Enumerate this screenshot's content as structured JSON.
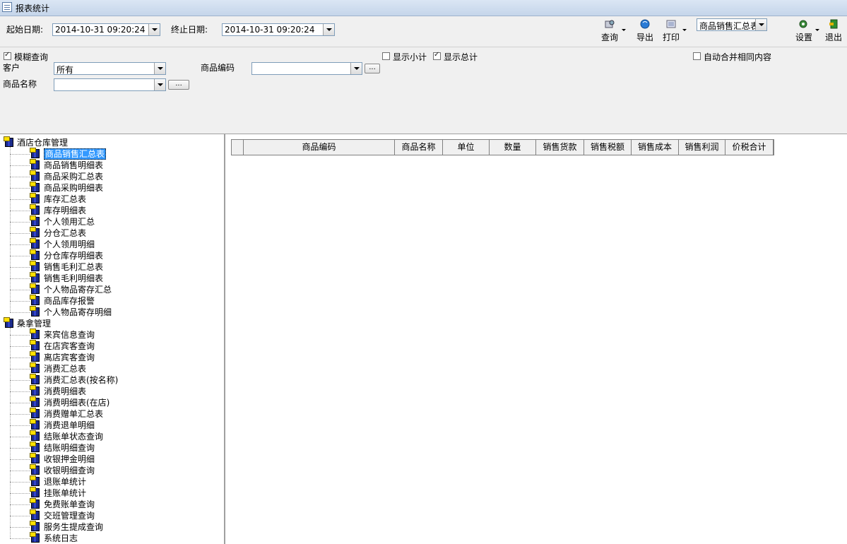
{
  "window": {
    "title": "报表统计"
  },
  "toolbar": {
    "start_label": "起始日期:",
    "start_value": "2014-10-31 09:20:24",
    "end_label": "终止日期:",
    "end_value": "2014-10-31 09:20:24",
    "query_label": "查询",
    "export_label": "导出",
    "print_label": "打印",
    "report_select": "商品销售汇总表",
    "settings_label": "设置",
    "exit_label": "退出"
  },
  "filter": {
    "fuzzy_label": "模糊查询",
    "fuzzy_checked": true,
    "customer_label": "客户",
    "customer_value": "所有",
    "product_code_label": "商品编码",
    "product_code_value": "",
    "product_name_label": "商品名称",
    "product_name_value": "",
    "dots_label": "...",
    "show_subtotal_label": "显示小计",
    "show_subtotal_checked": false,
    "show_total_label": "显示总计",
    "show_total_checked": true,
    "auto_merge_label": "自动合并相同内容",
    "auto_merge_checked": false
  },
  "tree": {
    "groups": [
      {
        "label": "酒店仓库管理",
        "items": [
          "商品销售汇总表",
          "商品销售明细表",
          "商品采购汇总表",
          "商品采购明细表",
          "库存汇总表",
          "库存明细表",
          "个人领用汇总",
          "分仓汇总表",
          "个人领用明细",
          "分仓库存明细表",
          "销售毛利汇总表",
          "销售毛利明细表",
          "个人物品寄存汇总",
          "商品库存报警",
          "个人物品寄存明细"
        ]
      },
      {
        "label": "桑拿管理",
        "items": [
          "来宾信息查询",
          "在店宾客查询",
          "离店宾客查询",
          "消费汇总表",
          "消费汇总表(按名称)",
          "消费明细表",
          "消费明细表(在店)",
          "消费赠单汇总表",
          "消费退单明细",
          "结账单状态查询",
          "结账明细查询",
          "收银押金明细",
          "收银明细查询",
          "退账单统计",
          "挂账单统计",
          "免费账单查询",
          "交班管理查询",
          "服务生提成查询",
          "系统日志"
        ]
      }
    ],
    "selected": "商品销售汇总表"
  },
  "grid": {
    "columns": [
      "",
      "商品编码",
      "商品名称",
      "单位",
      "数量",
      "销售货款",
      "销售税额",
      "销售成本",
      "销售利润",
      "价税合计"
    ]
  }
}
